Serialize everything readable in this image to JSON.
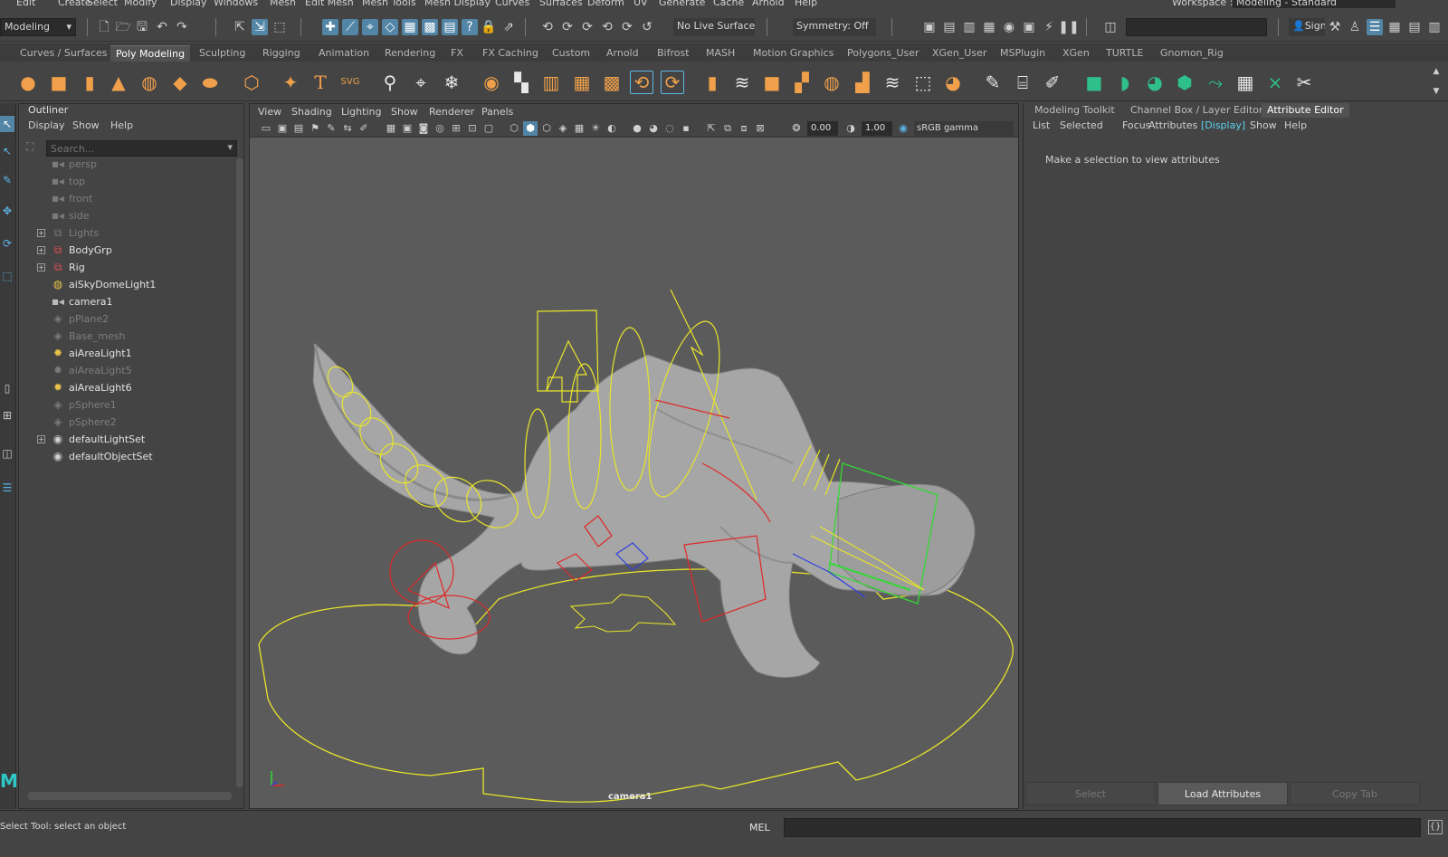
{
  "menu_bar": {
    "items": [
      "Edit",
      "Create",
      "Select",
      "Modify",
      "Display",
      "Windows",
      "Mesh",
      "Edit Mesh",
      "Mesh Tools",
      "Mesh Display",
      "Curves",
      "Surfaces",
      "Deform",
      "UV",
      "Generate",
      "Cache",
      "Arnold",
      "Help"
    ],
    "workspace_label": "Workspace :",
    "workspace_value": "Modeling - Standard"
  },
  "status_line": {
    "menu_set": "Modeling",
    "live_surface": "No Live Surface",
    "symmetry": "Symmetry: Off",
    "sign_in": "Sign"
  },
  "shelf_tabs": {
    "items": [
      "Curves / Surfaces",
      "Poly Modeling",
      "Sculpting",
      "Rigging",
      "Animation",
      "Rendering",
      "FX",
      "FX Caching",
      "Custom",
      "Arnold",
      "Bifrost",
      "MASH",
      "Motion Graphics",
      "Polygons_User",
      "XGen_User",
      "MSPlugin",
      "XGen",
      "TURTLE",
      "Gnomon_Rig"
    ],
    "active": "Poly Modeling"
  },
  "outliner": {
    "title": "Outliner",
    "menu": [
      "Display",
      "Show",
      "Help"
    ],
    "search_placeholder": "Search...",
    "items": [
      {
        "label": "persp",
        "icon": "camera-icon",
        "dim": true,
        "expandable": false
      },
      {
        "label": "top",
        "icon": "camera-icon",
        "dim": true,
        "expandable": false
      },
      {
        "label": "front",
        "icon": "camera-icon",
        "dim": true,
        "expandable": false
      },
      {
        "label": "side",
        "icon": "camera-icon",
        "dim": true,
        "expandable": false
      },
      {
        "label": "Lights",
        "icon": "group-icon",
        "dim": true,
        "expandable": true
      },
      {
        "label": "BodyGrp",
        "icon": "group-icon",
        "dim": false,
        "expandable": true
      },
      {
        "label": "Rig",
        "icon": "group-icon",
        "dim": false,
        "expandable": true
      },
      {
        "label": "aiSkyDomeLight1",
        "icon": "skydome-icon",
        "dim": false,
        "expandable": false
      },
      {
        "label": "camera1",
        "icon": "camera-icon",
        "dim": false,
        "expandable": false
      },
      {
        "label": "pPlane2",
        "icon": "mesh-icon",
        "dim": true,
        "expandable": false
      },
      {
        "label": "Base_mesh",
        "icon": "mesh-icon",
        "dim": true,
        "expandable": false
      },
      {
        "label": "aiAreaLight1",
        "icon": "area-light-icon",
        "dim": false,
        "expandable": false
      },
      {
        "label": "aiAreaLight5",
        "icon": "area-light-icon",
        "dim": true,
        "expandable": false
      },
      {
        "label": "aiAreaLight6",
        "icon": "area-light-icon",
        "dim": false,
        "expandable": false
      },
      {
        "label": "pSphere1",
        "icon": "mesh-icon",
        "dim": true,
        "expandable": false
      },
      {
        "label": "pSphere2",
        "icon": "mesh-icon",
        "dim": true,
        "expandable": false
      },
      {
        "label": "defaultLightSet",
        "icon": "set-icon",
        "dim": false,
        "expandable": true
      },
      {
        "label": "defaultObjectSet",
        "icon": "set-icon",
        "dim": false,
        "expandable": false
      }
    ]
  },
  "viewport": {
    "menu": [
      "View",
      "Shading",
      "Lighting",
      "Show",
      "Renderer",
      "Panels"
    ],
    "exposure": "0.00",
    "gamma": "1.00",
    "color_space": "sRGB gamma",
    "camera_label": "camera1"
  },
  "attribute_editor": {
    "tabs": [
      "Modeling Toolkit",
      "Channel Box / Layer Editor",
      "Attribute Editor"
    ],
    "active_tab": "Attribute Editor",
    "menu": [
      "List",
      "Selected",
      "Focus",
      "Attributes",
      "[Display]",
      "Show",
      "Help"
    ],
    "message": "Make a selection to view attributes",
    "buttons": [
      "Select",
      "Load Attributes",
      "Copy Tab"
    ]
  },
  "help_line": {
    "text": "Select Tool: select an object",
    "mel_label": "MEL"
  },
  "colors": {
    "accent": "#5285a6",
    "shelf_orange": "#f0a04b",
    "shelf_green": "#2fbf8a",
    "rig_yellow": "#e8e52a",
    "rig_red": "#e02828",
    "rig_blue": "#2d3ee0",
    "rig_green": "#33d933"
  }
}
